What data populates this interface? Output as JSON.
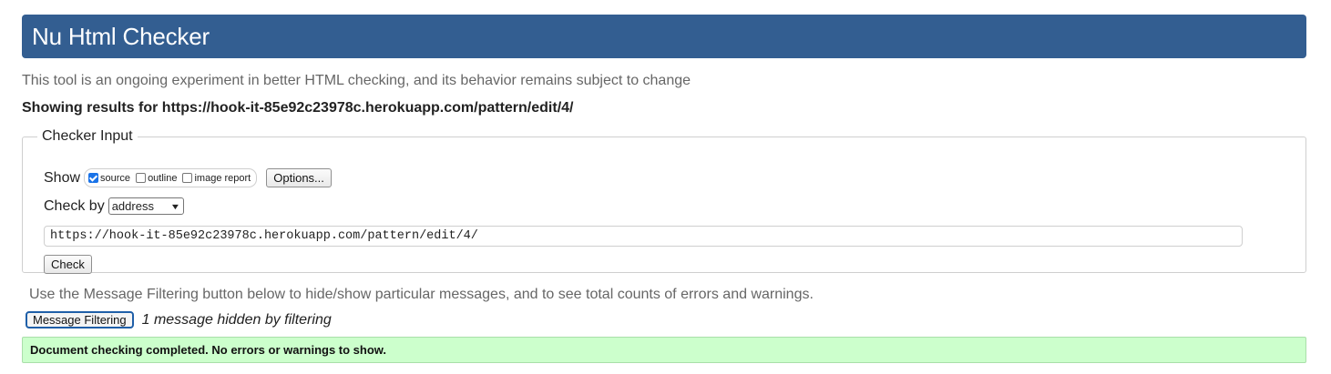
{
  "header": {
    "title": "Nu Html Checker"
  },
  "intro": "This tool is an ongoing experiment in better HTML checking, and its behavior remains subject to change",
  "showing": {
    "prefix": "Showing results for ",
    "url": "https://hook-it-85e92c23978c.herokuapp.com/pattern/edit/4/"
  },
  "checker": {
    "legend": "Checker Input",
    "show_label": "Show",
    "options": [
      {
        "label": "source",
        "checked": true
      },
      {
        "label": "outline",
        "checked": false
      },
      {
        "label": "image report",
        "checked": false
      }
    ],
    "options_button": "Options...",
    "check_by_label": "Check by",
    "check_by_value": "address",
    "url_value": "https://hook-it-85e92c23978c.herokuapp.com/pattern/edit/4/",
    "check_button": "Check"
  },
  "filter": {
    "note": "Use the Message Filtering button below to hide/show particular messages, and to see total counts of errors and warnings.",
    "button": "Message Filtering",
    "hidden": "1 message hidden by filtering"
  },
  "result": "Document checking completed. No errors or warnings to show.",
  "colors": {
    "header_bg": "#335e91",
    "success_bg": "#ccffcc",
    "checkbox_checked": "#1a73e8"
  }
}
